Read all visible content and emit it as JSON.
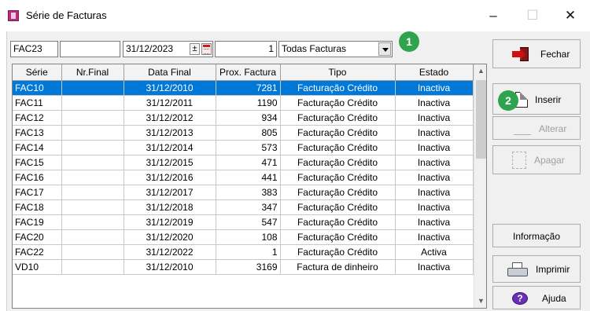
{
  "window": {
    "title": "Série de Facturas",
    "minimize_glyph": "–",
    "maximize_glyph": "☐",
    "close_glyph": "✕"
  },
  "filters": {
    "serie": "FAC23",
    "nr_final": "",
    "data_final": "31/12/2023",
    "prox_factura": "1",
    "tipo": "Todas Facturas"
  },
  "callouts": {
    "one": "1",
    "two": "2"
  },
  "grid": {
    "columns": [
      "Série",
      "Nr.Final",
      "Data Final",
      "Prox. Factura",
      "Tipo",
      "Estado"
    ],
    "rows": [
      {
        "serie": "FAC10",
        "nr_final": "",
        "data_final": "31/12/2010",
        "prox": "7281",
        "tipo": "Facturação Crédito",
        "estado": "Inactiva"
      },
      {
        "serie": "FAC11",
        "nr_final": "",
        "data_final": "31/12/2011",
        "prox": "1190",
        "tipo": "Facturação Crédito",
        "estado": "Inactiva"
      },
      {
        "serie": "FAC12",
        "nr_final": "",
        "data_final": "31/12/2012",
        "prox": "934",
        "tipo": "Facturação Crédito",
        "estado": "Inactiva"
      },
      {
        "serie": "FAC13",
        "nr_final": "",
        "data_final": "31/12/2013",
        "prox": "805",
        "tipo": "Facturação Crédito",
        "estado": "Inactiva"
      },
      {
        "serie": "FAC14",
        "nr_final": "",
        "data_final": "31/12/2014",
        "prox": "573",
        "tipo": "Facturação Crédito",
        "estado": "Inactiva"
      },
      {
        "serie": "FAC15",
        "nr_final": "",
        "data_final": "31/12/2015",
        "prox": "471",
        "tipo": "Facturação Crédito",
        "estado": "Inactiva"
      },
      {
        "serie": "FAC16",
        "nr_final": "",
        "data_final": "31/12/2016",
        "prox": "441",
        "tipo": "Facturação Crédito",
        "estado": "Inactiva"
      },
      {
        "serie": "FAC17",
        "nr_final": "",
        "data_final": "31/12/2017",
        "prox": "383",
        "tipo": "Facturação Crédito",
        "estado": "Inactiva"
      },
      {
        "serie": "FAC18",
        "nr_final": "",
        "data_final": "31/12/2018",
        "prox": "347",
        "tipo": "Facturação Crédito",
        "estado": "Inactiva"
      },
      {
        "serie": "FAC19",
        "nr_final": "",
        "data_final": "31/12/2019",
        "prox": "547",
        "tipo": "Facturação Crédito",
        "estado": "Inactiva"
      },
      {
        "serie": "FAC20",
        "nr_final": "",
        "data_final": "31/12/2020",
        "prox": "108",
        "tipo": "Facturação Crédito",
        "estado": "Inactiva"
      },
      {
        "serie": "FAC22",
        "nr_final": "",
        "data_final": "31/12/2022",
        "prox": "1",
        "tipo": "Facturação Crédito",
        "estado": "Activa"
      },
      {
        "serie": "VD10",
        "nr_final": "",
        "data_final": "31/12/2010",
        "prox": "3169",
        "tipo": "Factura de dinheiro",
        "estado": "Inactiva"
      }
    ],
    "selected_row": 0
  },
  "buttons": {
    "fechar": "Fechar",
    "inserir": "Inserir",
    "alterar": "Alterar",
    "apagar": "Apagar",
    "informacao": "Informação",
    "imprimir": "Imprimir",
    "ajuda": "Ajuda"
  },
  "colors": {
    "selection": "#0078d7",
    "callout": "#2ea44f"
  }
}
